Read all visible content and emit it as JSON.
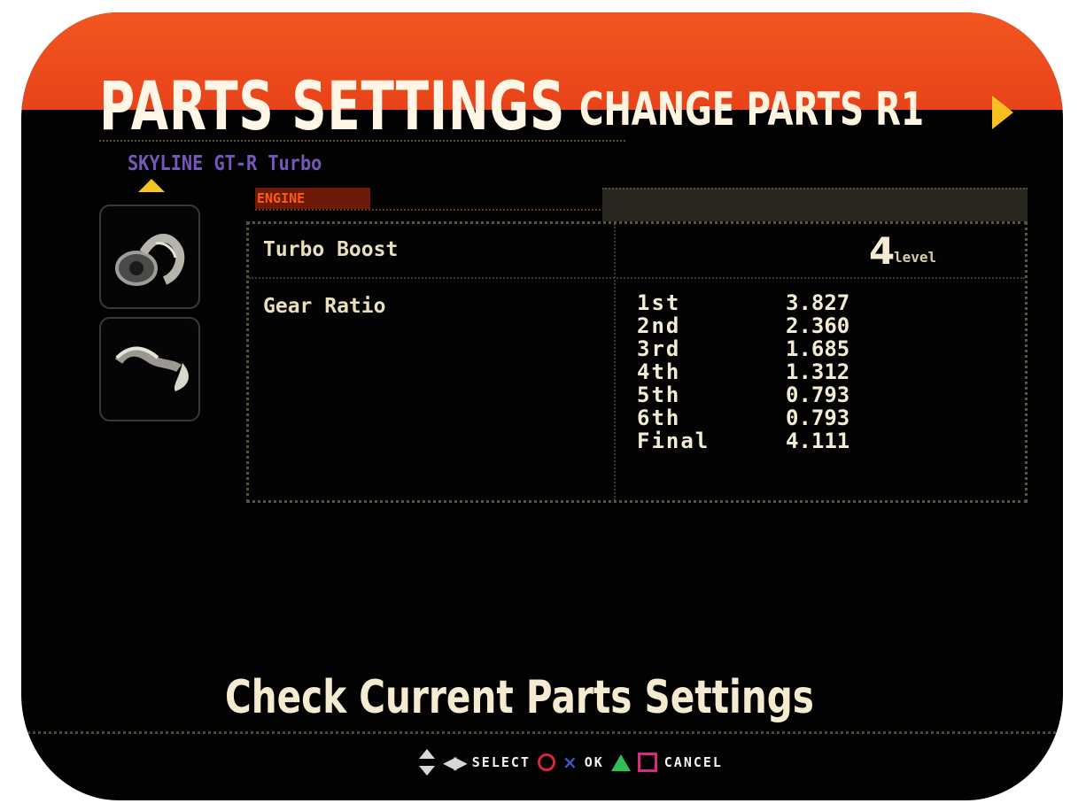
{
  "header": {
    "title": "PARTS SETTINGS",
    "change_parts_label": "CHANGE PARTS",
    "r1_label": "R1"
  },
  "breadcrumb": {
    "text": "SKYLINE GT-R Turbo"
  },
  "tabs": {
    "engine": "ENGINE"
  },
  "parts_slots": [
    {
      "icon": "turbo-icon"
    },
    {
      "icon": "transmission-icon"
    }
  ],
  "panel": {
    "turbo_label": "Turbo Boost",
    "turbo_value": "4",
    "turbo_unit": "level",
    "gear_label": "Gear Ratio",
    "gear_ratios": [
      {
        "gear": "1st",
        "ratio": "3.827"
      },
      {
        "gear": "2nd",
        "ratio": "2.360"
      },
      {
        "gear": "3rd",
        "ratio": "1.685"
      },
      {
        "gear": "4th",
        "ratio": "1.312"
      },
      {
        "gear": "5th",
        "ratio": "0.793"
      },
      {
        "gear": "6th",
        "ratio": "0.793"
      },
      {
        "gear": "Final",
        "ratio": "4.111"
      }
    ]
  },
  "hint": "Check Current Parts Settings",
  "controls": {
    "select_label": "SELECT",
    "ok_label": "OK",
    "cancel_label": "CANCEL"
  },
  "colors": {
    "accent_orange": "#e8431a",
    "arrow_yellow": "#f6c021",
    "breadcrumb_purple": "#7358b8",
    "circle_red": "#d7263d",
    "cross_blue": "#3f56c9",
    "triangle_green": "#2fbe58",
    "square_pink": "#d42b81"
  }
}
